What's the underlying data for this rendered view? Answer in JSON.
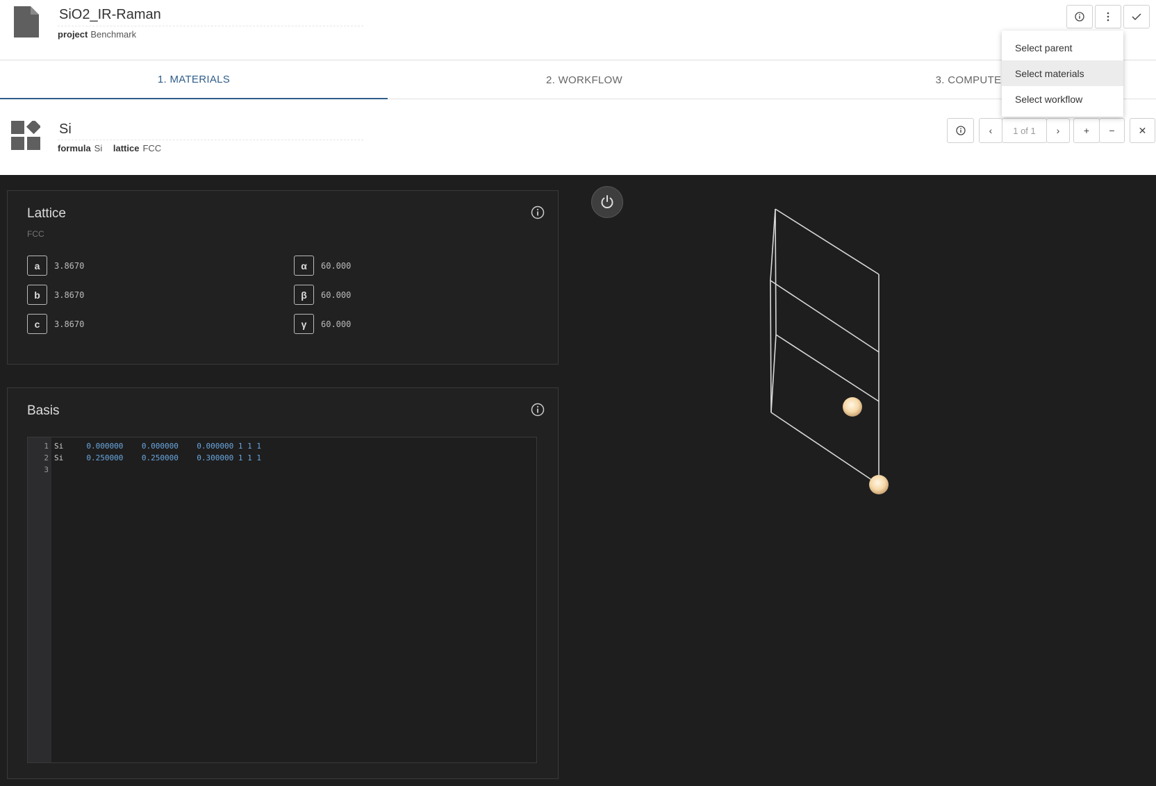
{
  "header": {
    "title": "SiO2_IR-Raman",
    "meta_key": "project",
    "meta_value": "Benchmark",
    "buttons": [
      "info-icon",
      "more-vert-icon",
      "check-icon"
    ]
  },
  "menu": {
    "items": [
      "Select parent",
      "Select materials",
      "Select workflow"
    ],
    "highlighted": "Select materials"
  },
  "tabs": [
    {
      "label": "1. MATERIALS",
      "active": true
    },
    {
      "label": "2. WORKFLOW",
      "active": false
    },
    {
      "label": "3. COMPUTE",
      "active": false
    }
  ],
  "material": {
    "title": "Si",
    "formula_label": "formula",
    "formula": "Si",
    "lattice_label": "lattice",
    "lattice": "FCC",
    "pager": "1 of 1"
  },
  "lattice": {
    "title": "Lattice",
    "type": "FCC",
    "params": [
      {
        "label": "a",
        "value": "3.8670"
      },
      {
        "label": "b",
        "value": "3.8670"
      },
      {
        "label": "c",
        "value": "3.8670"
      },
      {
        "label": "α",
        "value": "60.000"
      },
      {
        "label": "β",
        "value": "60.000"
      },
      {
        "label": "γ",
        "value": "60.000"
      }
    ]
  },
  "basis": {
    "title": "Basis",
    "lines": [
      {
        "num": "1",
        "element": "Si",
        "coords": "     0.000000    0.000000    0.000000 1 1 1"
      },
      {
        "num": "2",
        "element": "Si",
        "coords": "     0.250000    0.250000    0.300000 1 1 1"
      },
      {
        "num": "3",
        "element": "",
        "coords": ""
      }
    ]
  },
  "colors": {
    "accent": "#2f5d8a",
    "dark_bg": "#1e1e1e",
    "atom": "#f6d9a8"
  }
}
